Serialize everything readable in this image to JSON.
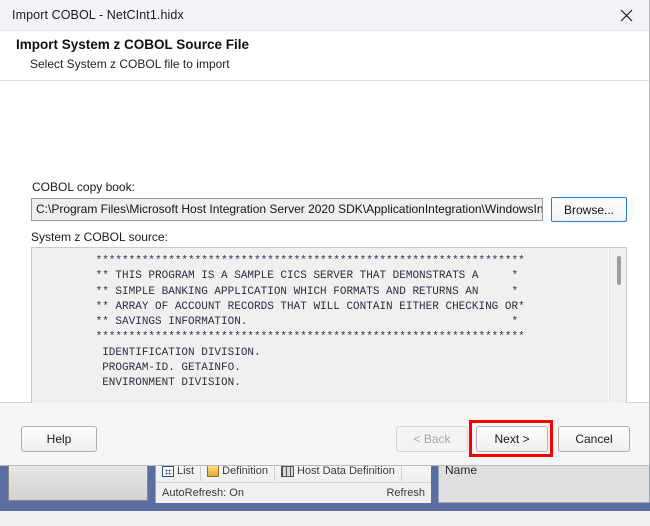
{
  "window": {
    "title": "Import COBOL - NetCInt1.hidx",
    "close_icon": "close-icon"
  },
  "header": {
    "title": "Import System z COBOL Source File",
    "subtitle": "Select System z COBOL file to import"
  },
  "form": {
    "copybook_label": "COBOL copy book:",
    "copybook_value": "C:\\Program Files\\Microsoft Host Integration Server 2020 SDK\\ApplicationIntegration\\WindowsInitiated\\Cics",
    "copybook_placeholder": "",
    "browse_label": "Browse...",
    "source_label": "System z COBOL source:",
    "source_text": "      *****************************************************************\n      ** THIS PROGRAM IS A SAMPLE CICS SERVER THAT DEMONSTRATS A     *\n      ** SIMPLE BANKING APPLICATION WHICH FORMATS AND RETURNS AN     *\n      ** ARRAY OF ACCOUNT RECORDS THAT WILL CONTAIN EITHER CHECKING OR*\n      ** SAVINGS INFORMATION.                                        *\n      *****************************************************************\n       IDENTIFICATION DIVISION.\n       PROGRAM-ID. GETAINFO.\n       ENVIRONMENT DIVISION.\n\n       DATA DIVISION.\n\n      *****************************************************************\n      ** VARIABLES FOR INTERACTING WITH THE TERMINAL SESSION         *"
  },
  "footer": {
    "help_label": "Help",
    "back_label": "< Back",
    "next_label": "Next >",
    "cancel_label": "Cancel"
  },
  "highlight": {
    "color": "#f80000",
    "target": "next-button"
  },
  "background_window": {
    "tabs": [
      {
        "label": "List",
        "icon": "list-grid-icon"
      },
      {
        "label": "Definition",
        "icon": "definition-icon"
      },
      {
        "label": "Host Data Definition",
        "icon": "host-data-definition-icon"
      }
    ],
    "autorefresh_label": "AutoRefresh: On",
    "refresh_label": "Refresh",
    "name_column_header": "Name"
  }
}
